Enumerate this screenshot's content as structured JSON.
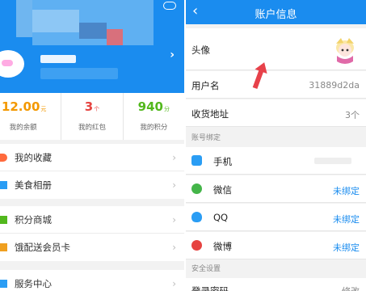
{
  "left": {
    "stats": [
      {
        "value": "12.00",
        "unit": "元",
        "label": "我的余额",
        "color": "orange"
      },
      {
        "value": "3",
        "unit": "个",
        "label": "我的红包",
        "color": "red"
      },
      {
        "value": "940",
        "unit": "分",
        "label": "我的积分",
        "color": "green"
      }
    ],
    "menu_groups": [
      [
        {
          "label": "我的收藏",
          "icon": "heart-icon",
          "icon_color": "#ff6a3d"
        },
        {
          "label": "美食相册",
          "icon": "album-icon",
          "icon_color": "#2a9df4"
        }
      ],
      [
        {
          "label": "积分商城",
          "icon": "points-mall-icon",
          "icon_color": "#52b81d"
        },
        {
          "label": "饿配送会员卡",
          "icon": "crown-icon",
          "icon_color": "#f0a020"
        }
      ],
      [
        {
          "label": "服务中心",
          "icon": "service-icon",
          "icon_color": "#2a9df4"
        }
      ]
    ],
    "colors": {
      "brand": "#1a8cef",
      "orange": "#f39800",
      "red": "#e64340",
      "green": "#52b81d"
    }
  },
  "right": {
    "title": "账户信息",
    "rows": {
      "avatar_label": "头像",
      "username_label": "用户名",
      "username_value": "31889d2da",
      "address_label": "收货地址",
      "address_value": "3个"
    },
    "bind_section_title": "账号绑定",
    "bindings": [
      {
        "label": "手机",
        "value": "",
        "icon": "phone-icon",
        "icon_color": "#2a9df4"
      },
      {
        "label": "微信",
        "value": "未绑定",
        "icon": "wechat-icon",
        "icon_color": "#44b549"
      },
      {
        "label": "QQ",
        "value": "未绑定",
        "icon": "qq-icon",
        "icon_color": "#2a9df4"
      },
      {
        "label": "微博",
        "value": "未绑定",
        "icon": "weibo-icon",
        "icon_color": "#e64340"
      }
    ],
    "security_section_title": "安全设置",
    "security_first_row": "登录密码",
    "security_first_value": "修改"
  }
}
